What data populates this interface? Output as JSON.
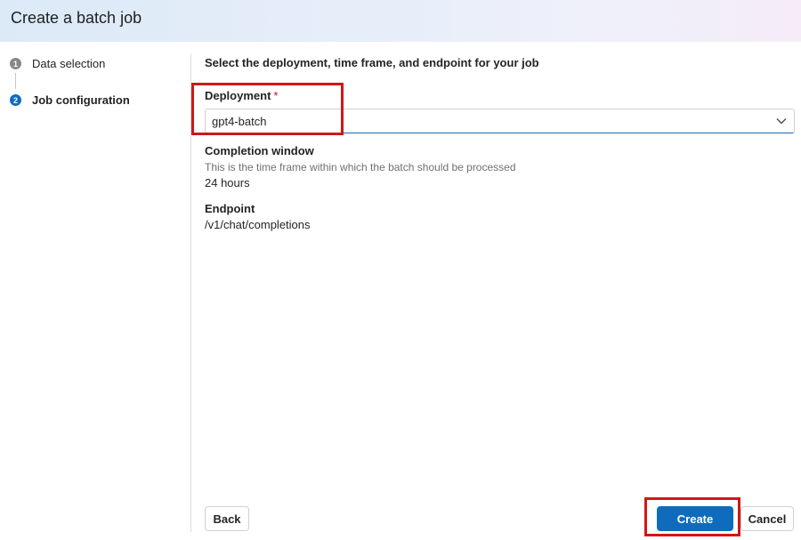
{
  "header": {
    "title": "Create a batch job"
  },
  "steps": [
    {
      "number": "1",
      "label": "Data selection",
      "state": "completed"
    },
    {
      "number": "2",
      "label": "Job configuration",
      "state": "active"
    }
  ],
  "main": {
    "section_title": "Select the deployment, time frame, and endpoint for your job",
    "deployment": {
      "label": "Deployment",
      "required_marker": "*",
      "value": "gpt4-batch"
    },
    "completion_window": {
      "label": "Completion window",
      "hint": "This is the time frame within which the batch should be processed",
      "value": "24 hours"
    },
    "endpoint": {
      "label": "Endpoint",
      "value": "/v1/chat/completions"
    }
  },
  "footer": {
    "back_label": "Back",
    "create_label": "Create",
    "cancel_label": "Cancel"
  },
  "colors": {
    "accent": "#0f6cbd",
    "highlight": "#d31616",
    "required": "#c50f1f"
  },
  "icons": {
    "dropdown": "chevron-down-icon"
  }
}
